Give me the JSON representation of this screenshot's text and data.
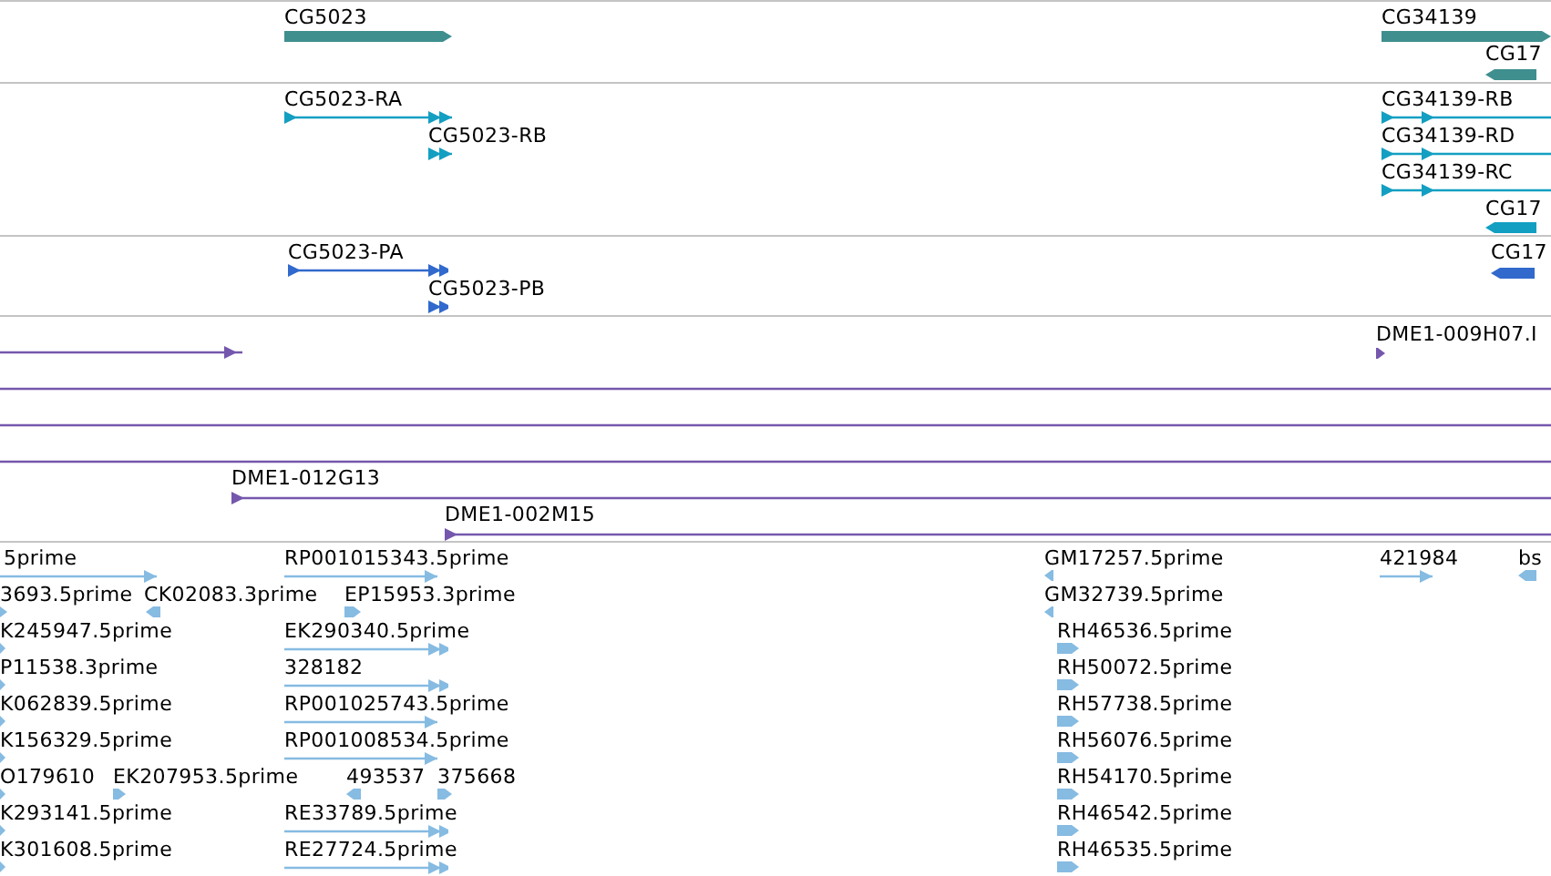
{
  "tracks": [
    {
      "color": "#3f8f8f",
      "features": [
        {
          "label": "CG5023",
          "kind": "gene",
          "reverse": false
        },
        {
          "label": "CG34139",
          "kind": "gene",
          "reverse": false
        },
        {
          "label": "CG17",
          "kind": "gene",
          "reverse": true
        }
      ]
    },
    {
      "color": "#139fc2",
      "features": [
        {
          "label": "CG5023-RA",
          "kind": "transcript",
          "reverse": false
        },
        {
          "label": "CG5023-RB",
          "kind": "transcript",
          "reverse": false
        },
        {
          "label": "CG34139-RB",
          "kind": "transcript",
          "reverse": false
        },
        {
          "label": "CG34139-RD",
          "kind": "transcript",
          "reverse": false
        },
        {
          "label": "CG34139-RC",
          "kind": "transcript",
          "reverse": false
        },
        {
          "label": "CG17",
          "kind": "gene",
          "reverse": true
        }
      ]
    },
    {
      "color": "#3169cc",
      "features": [
        {
          "label": "CG5023-PA",
          "kind": "transcript",
          "reverse": false
        },
        {
          "label": "CG5023-PB",
          "kind": "transcript",
          "reverse": false
        },
        {
          "label": "CG17",
          "kind": "gene",
          "reverse": true
        }
      ]
    },
    {
      "color": "#7557ad",
      "features": [
        {
          "kind": "transcript",
          "reverse": false
        },
        {
          "label": "DME1-009H07.I",
          "kind": "read",
          "reverse": false
        },
        {
          "kind": "span"
        },
        {
          "kind": "span"
        },
        {
          "kind": "span"
        },
        {
          "label": "DME1-012G13",
          "kind": "transcript",
          "reverse": false
        },
        {
          "label": "DME1-002M15",
          "kind": "transcript",
          "reverse": false
        }
      ]
    },
    {
      "color": "#86bbe2",
      "features": [
        {
          "label": "5prime",
          "kind": "transcript",
          "reverse": false
        },
        {
          "label": "RP001015343.5prime",
          "kind": "transcript",
          "reverse": false
        },
        {
          "label": "GM17257.5prime",
          "kind": "read",
          "reverse": true
        },
        {
          "label": "421984",
          "kind": "transcript",
          "reverse": false
        },
        {
          "label": "bs",
          "kind": "read",
          "reverse": true
        },
        {
          "label": "3693.5prime",
          "kind": "read",
          "reverse": false
        },
        {
          "label": "CK02083.3prime",
          "kind": "read",
          "reverse": true
        },
        {
          "label": "EP15953.3prime",
          "kind": "read",
          "reverse": false
        },
        {
          "label": "GM32739.5prime",
          "kind": "read",
          "reverse": true
        },
        {
          "label": "K245947.5prime",
          "kind": "read",
          "reverse": false
        },
        {
          "label": "EK290340.5prime",
          "kind": "transcript",
          "reverse": false
        },
        {
          "label": "RH46536.5prime",
          "kind": "read",
          "reverse": false
        },
        {
          "label": "P11538.3prime",
          "kind": "read",
          "reverse": false
        },
        {
          "label": "328182",
          "kind": "transcript",
          "reverse": false
        },
        {
          "label": "RH50072.5prime",
          "kind": "read",
          "reverse": false
        },
        {
          "label": "K062839.5prime",
          "kind": "read",
          "reverse": false
        },
        {
          "label": "RP001025743.5prime",
          "kind": "transcript",
          "reverse": false
        },
        {
          "label": "RH57738.5prime",
          "kind": "read",
          "reverse": false
        },
        {
          "label": "K156329.5prime",
          "kind": "read",
          "reverse": false
        },
        {
          "label": "RP001008534.5prime",
          "kind": "transcript",
          "reverse": false
        },
        {
          "label": "RH56076.5prime",
          "kind": "read",
          "reverse": false
        },
        {
          "label": "O179610",
          "kind": "read",
          "reverse": false
        },
        {
          "label": "EK207953.5prime",
          "kind": "read",
          "reverse": false
        },
        {
          "label": "493537",
          "kind": "read",
          "reverse": true
        },
        {
          "label": "375668",
          "kind": "read",
          "reverse": false
        },
        {
          "label": "RH54170.5prime",
          "kind": "read",
          "reverse": false
        },
        {
          "label": "K293141.5prime",
          "kind": "read",
          "reverse": false
        },
        {
          "label": "RE33789.5prime",
          "kind": "transcript",
          "reverse": false
        },
        {
          "label": "RH46542.5prime",
          "kind": "read",
          "reverse": false
        },
        {
          "label": "K301608.5prime",
          "kind": "read",
          "reverse": false
        },
        {
          "label": "RE27724.5prime",
          "kind": "transcript",
          "reverse": false
        },
        {
          "label": "RH46535.5prime",
          "kind": "read",
          "reverse": false
        }
      ]
    }
  ]
}
